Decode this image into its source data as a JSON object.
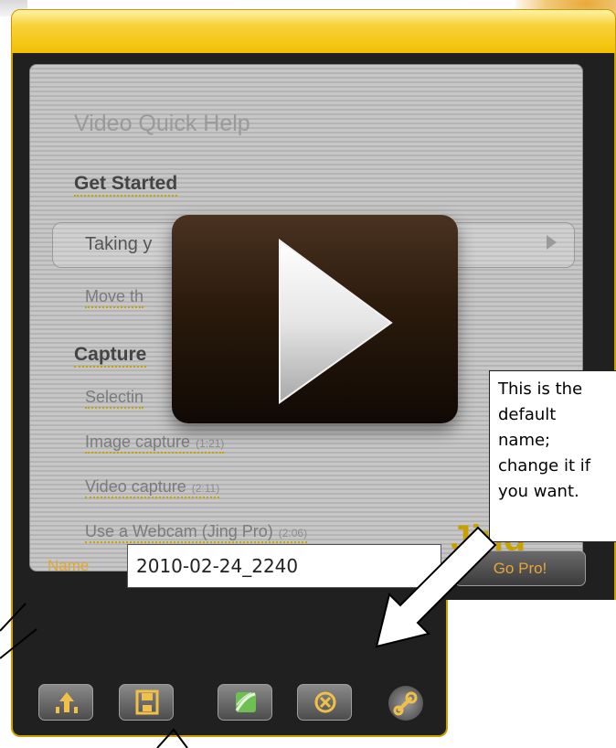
{
  "help_panel": {
    "title": "Video Quick Help",
    "get_started_heading": "Get Started",
    "taking_row_label": "Taking y",
    "move_link": "Move th",
    "capture_heading": "Capture",
    "selecting_link": "Selectin",
    "links": [
      {
        "label": "Image capture",
        "duration": "(1:21)"
      },
      {
        "label": "Video capture",
        "duration": "(2:11)"
      },
      {
        "label": "Use a Webcam (Jing Pro)",
        "duration": "(2:06)"
      }
    ],
    "jing_mark": "Jing"
  },
  "name_row": {
    "label": "Name",
    "value": "2010-02-24_2240"
  },
  "gopro_label": "Go Pro!",
  "toolbar": [
    {
      "icon": "upload-icon"
    },
    {
      "icon": "save-icon"
    },
    {
      "icon": "screencast-icon"
    },
    {
      "icon": "cancel-icon"
    },
    {
      "icon": "settings-icon"
    }
  ],
  "callout_text": "This is the\ndefault\nname;\nchange it if\nyou want.",
  "colors": {
    "accent": "#f2bf00",
    "label_orange": "#e4a62a",
    "window_bg": "#202020"
  }
}
